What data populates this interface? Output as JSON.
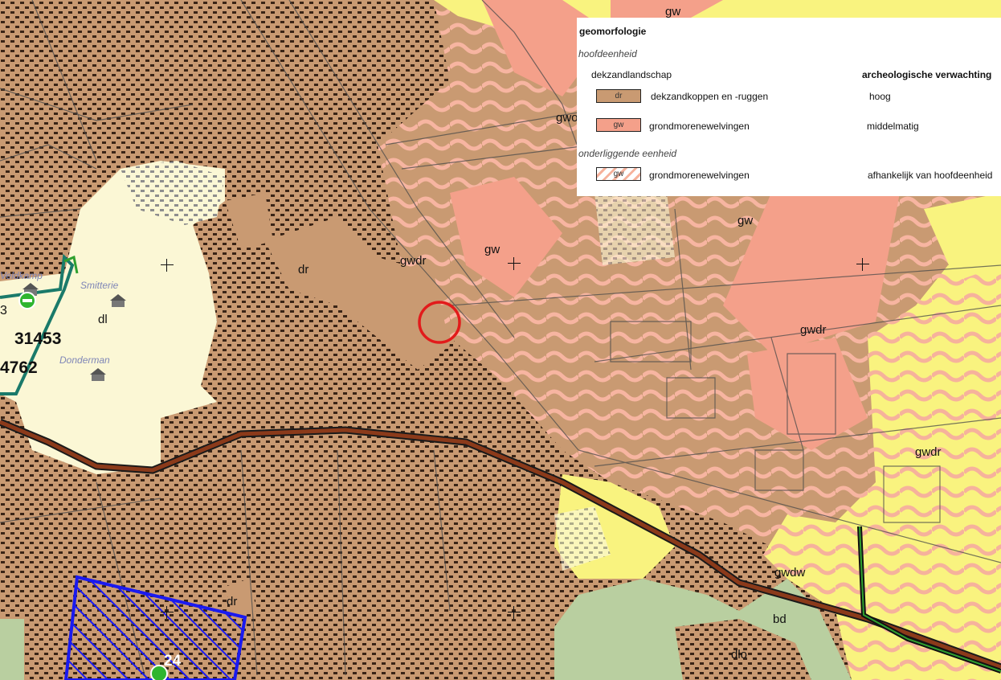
{
  "legend": {
    "title": "geomorfologie",
    "section_main": "hoofdeenheid",
    "landscape": "dekzandlandschap",
    "column_header": "archeologische verwachting",
    "rows": [
      {
        "code": "dr",
        "label": "dekzandkoppen en -ruggen",
        "expectation": "hoog",
        "color": "#c99a72"
      },
      {
        "code": "gw",
        "label": "grondmorenewelvingen",
        "expectation": "middelmatig",
        "color": "#f4a08a"
      }
    ],
    "section_sub": "onderliggende eenheid",
    "sub_rows": [
      {
        "code": "gw",
        "label": "grondmorenewelvingen",
        "expectation": "afhankelijk van hoofdeenheid"
      }
    ]
  },
  "map_labels": {
    "gw_top": "gw",
    "gw_right": "gwo",
    "gw_center": "gw",
    "gw_east": "gw",
    "gwdr_center": "gwdr",
    "gwdr_east": "gwdr",
    "gwdr_south": "gwdr",
    "dr_center": "dr",
    "dr_south": "dr",
    "dl": "dl",
    "gwdw": "gwdw",
    "bd": "bd",
    "dlo": "dlo"
  },
  "places": {
    "veldkamp": "Veldkamp",
    "smitterie": "Smitterie",
    "donderman": "Donderman"
  },
  "numbers": {
    "n1": "31453",
    "n2": "4762",
    "n3": "3",
    "n4": "24"
  },
  "colors": {
    "dekzand": "#c99a72",
    "grondmorene": "#f4a08a",
    "built": "#fbf7d5",
    "yellow": "#f9f37f",
    "green": "#b9cfa0",
    "road": "#8b3a1a",
    "protected": "#1a1af0",
    "marker": "#e21b1b"
  },
  "icons": [
    "monument-icon",
    "location-marker-icon",
    "hatched-area",
    "road-line"
  ]
}
